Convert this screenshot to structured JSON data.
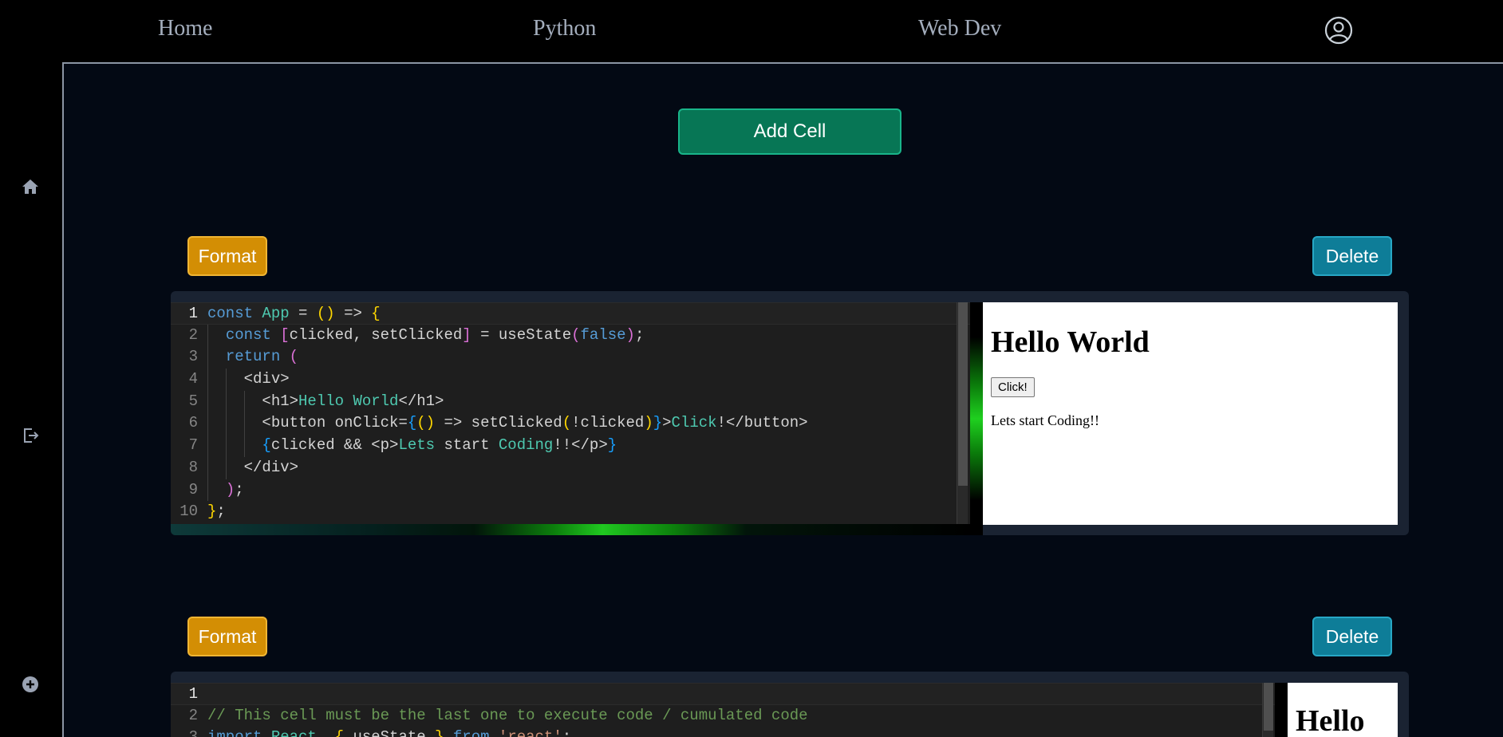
{
  "nav": {
    "home": "Home",
    "python": "Python",
    "webdev": "Web Dev",
    "profile_icon": "user-circle-icon"
  },
  "sidebar": {
    "icons": [
      "home-icon",
      "logout-icon",
      "add-circle-icon"
    ]
  },
  "toolbar": {
    "add_cell": "Add Cell"
  },
  "cells": [
    {
      "format_label": "Format",
      "delete_label": "Delete",
      "code_lines": [
        "const App = () => {",
        "  const [clicked, setClicked] = useState(false);",
        "  return (",
        "    <div>",
        "      <h1>Hello World</h1>",
        "      <button onClick={() => setClicked(!clicked)}>Click!</button>",
        "      {clicked && <p>Lets start Coding!!</p>}",
        "    </div>",
        "  );",
        "};"
      ],
      "preview": {
        "heading": "Hello World",
        "button": "Click!",
        "paragraph": "Lets start Coding!!"
      }
    },
    {
      "format_label": "Format",
      "delete_label": "Delete",
      "code_lines": [
        "",
        "// This cell must be the last one to execute code / cumulated code",
        "import React, { useState } from 'react';"
      ],
      "preview": {
        "heading": "Hello"
      }
    }
  ],
  "colors": {
    "background": "#030914",
    "add_button": "#077655",
    "format_button": "#d38e04",
    "delete_button": "#0e7d98",
    "editor": "#1e1e1e"
  }
}
